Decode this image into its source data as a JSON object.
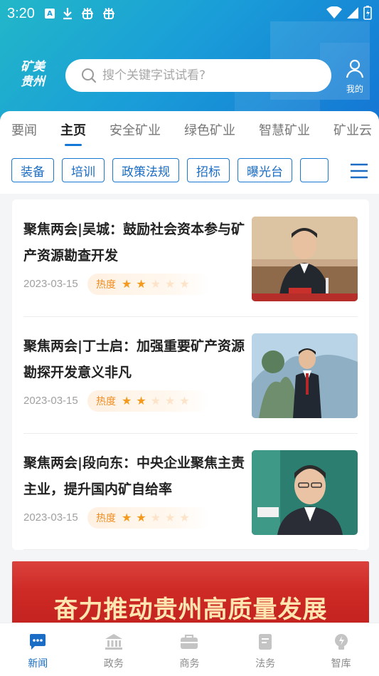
{
  "status_bar": {
    "time": "3:20",
    "notif_letter": "A"
  },
  "header": {
    "logo_line1": "矿美",
    "logo_line2": "贵州",
    "search": {
      "placeholder": "搜个关键字试试看?",
      "value": ""
    },
    "profile_label": "我的"
  },
  "tabs": [
    {
      "label": "要闻",
      "active": false
    },
    {
      "label": "主页",
      "active": true
    },
    {
      "label": "安全矿业",
      "active": false
    },
    {
      "label": "绿色矿业",
      "active": false
    },
    {
      "label": "智慧矿业",
      "active": false
    },
    {
      "label": "矿业云",
      "active": false
    }
  ],
  "chips": [
    "装备",
    "培训",
    "政策法规",
    "招标",
    "曝光台",
    ""
  ],
  "news": [
    {
      "title": "聚焦两会|吴城：鼓励社会资本参与矿产资源勘查开发",
      "date": "2023-03-15",
      "heat_label": "热度",
      "stars": 2,
      "max_stars": 5
    },
    {
      "title": "聚焦两会|丁士启：加强重要矿产资源勘探开发意义非凡",
      "date": "2023-03-15",
      "heat_label": "热度",
      "stars": 2,
      "max_stars": 5
    },
    {
      "title": "聚焦两会|段向东：中央企业聚焦主责主业，提升国内矿自给率",
      "date": "2023-03-15",
      "heat_label": "热度",
      "stars": 2,
      "max_stars": 5
    }
  ],
  "banner": {
    "text": "奋力推动贵州高质量发展"
  },
  "bottom_nav": [
    {
      "label": "新闻",
      "icon": "news-icon",
      "active": true
    },
    {
      "label": "政务",
      "icon": "government-icon",
      "active": false
    },
    {
      "label": "商务",
      "icon": "briefcase-icon",
      "active": false
    },
    {
      "label": "法务",
      "icon": "document-icon",
      "active": false
    },
    {
      "label": "智库",
      "icon": "lightbulb-icon",
      "active": false
    }
  ],
  "colors": {
    "accent": "#1a6cc4",
    "header_start": "#22b7c8",
    "header_end": "#1475d4",
    "star": "#f39a1d"
  }
}
